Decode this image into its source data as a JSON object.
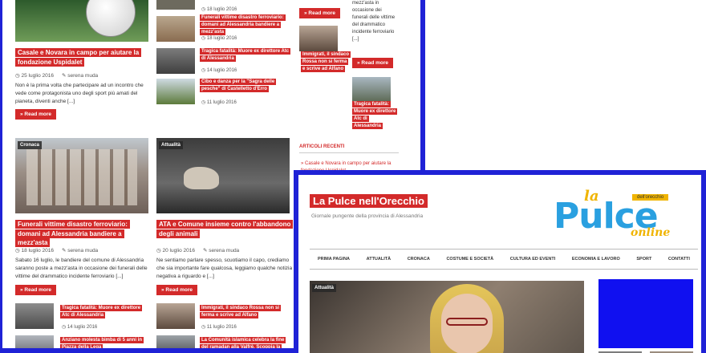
{
  "back": {
    "top_left": {
      "title": "Casale e Novara in campo per aiutare la fondazione Uspidalet",
      "date": "25 luglio 2016",
      "author": "serena muda",
      "excerpt": "Non è la prima volta che partecipare ad un incontro che vede come protagonista uno degli sport più amati del pianeta, diventi anche [...]",
      "read_more": "Read more"
    },
    "top_list": [
      {
        "date": "18 luglio 2016"
      },
      {
        "title": "Funerali vittime disastro ferroviario: domani ad Alessandria bandiere a mezz'asta",
        "date": "18 luglio 2016"
      },
      {
        "title": "Tragica fatalità: Muore ex direttore Atc di Alessandria",
        "date": "14 luglio 2016"
      },
      {
        "title": "Cibo e danza per la \"Sagra delle pesche\" di Castelletto d'Erro",
        "date": "11 luglio 2016"
      }
    ],
    "col3": {
      "read_more_1": "Read more",
      "item": {
        "title": "Immigrati, il sindaco Rossa non si ferma e scrive ad Alfano"
      },
      "recent_heading": "ARTICOLI RECENTI",
      "recent_1": "Casale e Novara in campo per aiutare la fondazione Uspidalet"
    },
    "col4": {
      "excerpt": "mezz'asta in occasione dei funerali delle vittime del drammatico incidente ferroviario [...]",
      "read_more": "Read more",
      "item_title": "Tragica fatalità: Muore ex direttore Atc di Alessandria"
    },
    "cronaca": {
      "cat": "Cronaca",
      "title": "Funerali vittime disastro ferroviario: domani ad Alessandria bandiere a mezz'asta",
      "date": "18 luglio 2016",
      "author": "serena muda",
      "excerpt": "Sabato 16 luglio, le bandiere del comune di Alessandria saranno poste a mezz'asta in occasione dei funerali delle vittime del drammatico incidente ferroviario [...]",
      "read_more": "Read more"
    },
    "attualita": {
      "cat": "Attualità",
      "title": "ATA e Comune insieme contro l'abbandono degli animali",
      "date": "20 luglio 2016",
      "author": "serena muda",
      "excerpt": "Ne sentiamo parlare spesso, scuotiamo il capo, crediamo che sia importante fare qualcosa, leggiamo qualche notizia negativa a riguardo e [...]",
      "read_more": "Read more"
    },
    "bottom_left": [
      {
        "title": "Tragica fatalità: Muore ex direttore Atc di Alessandria",
        "date": "14 luglio 2016"
      },
      {
        "title": "Anziano molesta bimba di 5 anni in Piazza della Lega"
      }
    ],
    "bottom_right": [
      {
        "title": "Immigrati, il sindaco Rossa non si ferma e scrive ad Alfano",
        "date": "11 luglio 2016"
      },
      {
        "title": "La Comunità islamica celebra la fine del ramadan alla Valfrè. Scoppia la polemica."
      }
    ]
  },
  "front": {
    "site_title": "La Pulce nell'Orecchio",
    "tagline": "Giornale pungente della provincia di Alessandria",
    "logo": {
      "top": "la",
      "main": "Pulce",
      "sub": "online",
      "badge": "dell'orecchio"
    },
    "nav": [
      "PRIMA PAGINA",
      "ATTUALITÀ",
      "CRONACA",
      "COSTUME E SOCIETÀ",
      "CULTURA ED EVENTI",
      "ECONOMIA E LAVORO",
      "SPORT",
      "CONTATTI"
    ],
    "hero_cat": "Attualità"
  },
  "colors": {
    "accent_red": "#d32a2a",
    "frame_blue": "#1f22d6",
    "ad_blue": "#1010f0"
  }
}
